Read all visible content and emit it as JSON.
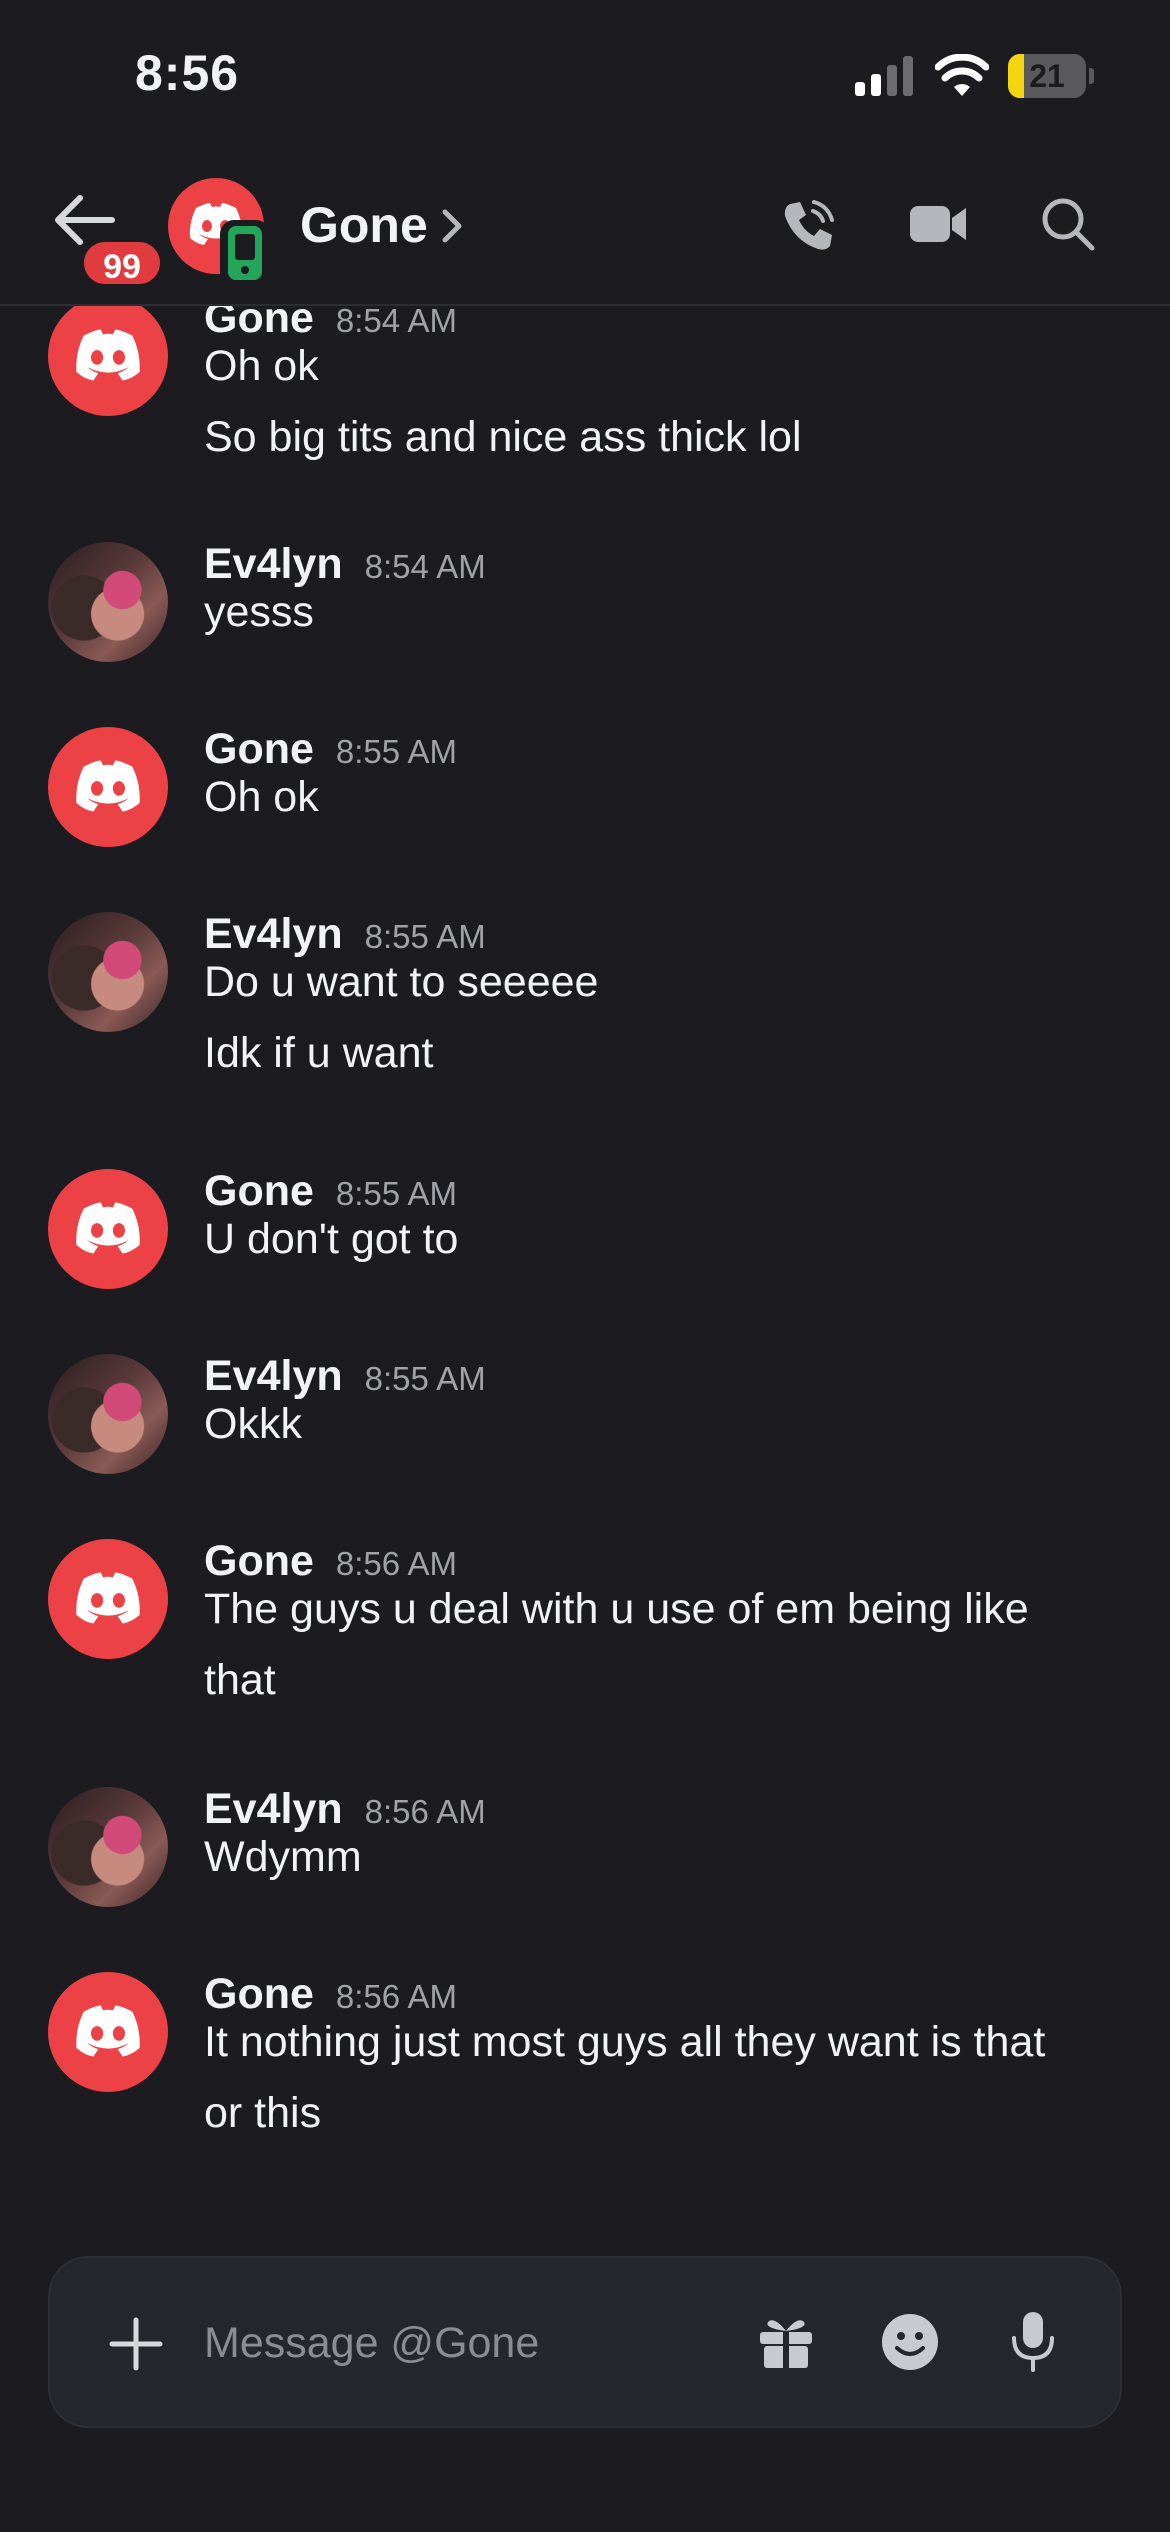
{
  "status_bar": {
    "time": "8:56",
    "battery_level": "21",
    "battery_fraction": 0.21
  },
  "header": {
    "unread_badge": "99",
    "channel_name": "Gone",
    "avatar_color": "#ed4245",
    "mobile_status_color": "#23a55a"
  },
  "messages": [
    {
      "author": "Gone",
      "time": "8:54 AM",
      "avatar": "discord-default",
      "lines": [
        "Oh ok",
        "So big tits and nice ass thick lol"
      ]
    },
    {
      "author": "Ev4lyn",
      "time": "8:54 AM",
      "avatar": "photo",
      "lines": [
        "yesss"
      ]
    },
    {
      "author": "Gone",
      "time": "8:55 AM",
      "avatar": "discord-default",
      "lines": [
        "Oh ok"
      ]
    },
    {
      "author": "Ev4lyn",
      "time": "8:55 AM",
      "avatar": "photo",
      "lines": [
        "Do u want to seeeee",
        "Idk if u want"
      ]
    },
    {
      "author": "Gone",
      "time": "8:55 AM",
      "avatar": "discord-default",
      "lines": [
        "U don't got to"
      ]
    },
    {
      "author": "Ev4lyn",
      "time": "8:55 AM",
      "avatar": "photo",
      "lines": [
        "Okkk"
      ]
    },
    {
      "author": "Gone",
      "time": "8:56 AM",
      "avatar": "discord-default",
      "lines": [
        "The guys u deal with u use of em being like",
        "that"
      ]
    },
    {
      "author": "Ev4lyn",
      "time": "8:56 AM",
      "avatar": "photo",
      "lines": [
        "Wdymm"
      ]
    },
    {
      "author": "Gone",
      "time": "8:56 AM",
      "avatar": "discord-default",
      "lines": [
        "It nothing just most guys all they want is that",
        "or this"
      ]
    }
  ],
  "composer": {
    "placeholder": "Message @Gone",
    "value": ""
  },
  "icons": {
    "back": "arrow-left-icon",
    "chevron": "chevron-right-icon",
    "call": "phone-icon",
    "video": "video-camera-icon",
    "search": "search-icon",
    "plus": "plus-icon",
    "gift": "gift-icon",
    "emoji": "emoji-icon",
    "mic": "microphone-icon"
  },
  "colors": {
    "background": "#1b1b20",
    "accent_red": "#ed4245",
    "online_green": "#23a55a",
    "battery_yellow": "#f5d50f"
  }
}
